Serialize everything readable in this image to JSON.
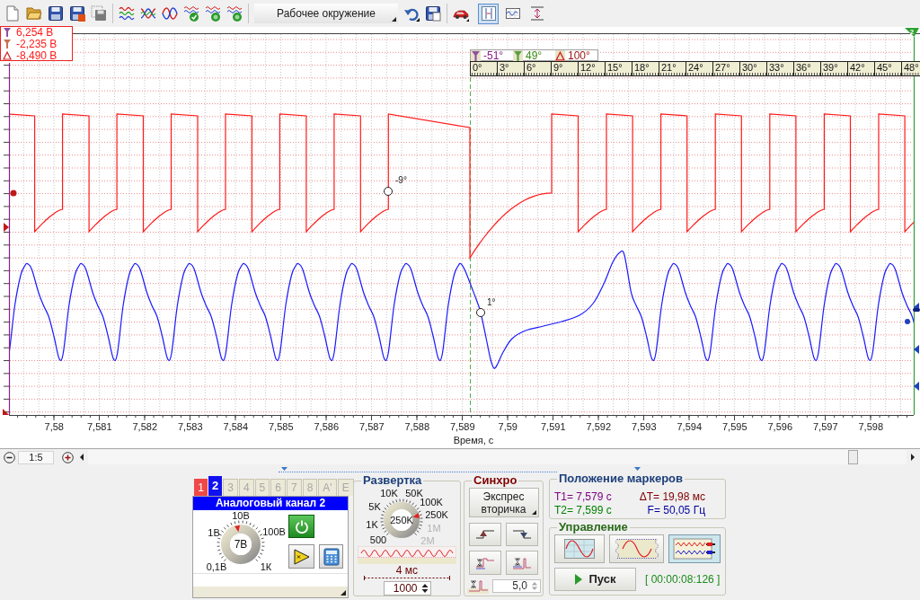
{
  "toolbar": {
    "workspace_dropdown": "Рабочее окружение",
    "view_toggles": [
      {
        "selected": true
      },
      {
        "selected": false
      },
      {
        "selected": false
      }
    ]
  },
  "plot": {
    "voltage_readout": [
      {
        "kind": "t1",
        "value": "6,254 В"
      },
      {
        "kind": "t2",
        "value": "-2,235 В"
      },
      {
        "kind": "delta",
        "value": "-8,490 В"
      }
    ],
    "cursor_t2_label": "2",
    "phase_readout": [
      {
        "kind": "t1",
        "value": "-51°",
        "color": "#8a1a8a"
      },
      {
        "kind": "t2",
        "value": "49°",
        "color": "#3a8a10"
      },
      {
        "kind": "delta",
        "value": "100°",
        "color": "#9a1010"
      }
    ],
    "phase_scale": [
      "0°",
      "3°",
      "6°",
      "9°",
      "12°",
      "15°",
      "18°",
      "21°",
      "24°",
      "27°",
      "30°",
      "33°",
      "36°",
      "39°",
      "42°",
      "45°",
      "48°"
    ],
    "point_labels": [
      "-9°",
      "1°"
    ],
    "x_axis": {
      "ticks": [
        "7,58",
        "7,581",
        "7,582",
        "7,583",
        "7,584",
        "7,585",
        "7,586",
        "7,587",
        "7,588",
        "7,589",
        "7,59",
        "7,591",
        "7,592",
        "7,593",
        "7,594",
        "7,595",
        "7,596",
        "7,597",
        "7,598"
      ],
      "label": "Время, с"
    }
  },
  "scroll": {
    "zoom": "1:5"
  },
  "channel_panel": {
    "tabs": [
      {
        "label": "1",
        "selected": false,
        "color": "#f04848"
      },
      {
        "label": "2",
        "selected": true,
        "color": "#1010f0"
      },
      {
        "label": "3",
        "selected": false
      },
      {
        "label": "4",
        "selected": false
      },
      {
        "label": "5",
        "selected": false
      },
      {
        "label": "6",
        "selected": false
      },
      {
        "label": "7",
        "selected": false
      },
      {
        "label": "8",
        "selected": false
      },
      {
        "label": "A'",
        "selected": false
      },
      {
        "label": "E",
        "selected": false
      }
    ],
    "title": "Аналоговый канал 2",
    "knob": {
      "value": "7В",
      "level": 0.46,
      "labels": [
        {
          "text": "10В",
          "enabled": true
        },
        {
          "text": "1В",
          "enabled": true
        },
        {
          "text": "100В",
          "enabled": true
        },
        {
          "text": "0,1В",
          "enabled": true
        },
        {
          "text": "1К",
          "enabled": true
        }
      ]
    },
    "power_on": true
  },
  "timebase_panel": {
    "title": "Развертка",
    "knob": {
      "value": "250K",
      "level": 0.78,
      "labels": [
        {
          "text": "10K",
          "enabled": true
        },
        {
          "text": "50K",
          "enabled": true
        },
        {
          "text": "5K",
          "enabled": true
        },
        {
          "text": "100K",
          "enabled": true
        },
        {
          "text": "250K",
          "enabled": true
        },
        {
          "text": "1K",
          "enabled": true
        },
        {
          "text": "1M",
          "enabled": false
        },
        {
          "text": "500",
          "enabled": true
        },
        {
          "text": "2M",
          "enabled": false
        }
      ]
    },
    "span": "4 мс",
    "points": "1000"
  },
  "sync_panel": {
    "title": "Синхро",
    "mode_button": "Экспрес вторичка",
    "threshold": "5,0"
  },
  "markers_panel": {
    "title": "Положение маркеров",
    "values": [
      {
        "text": "T1= 7,579 с",
        "color": "#800080"
      },
      {
        "text": "ΔT= 19,98 мс",
        "color": "#800000"
      },
      {
        "text": "T2= 7,599 с",
        "color": "#008000"
      },
      {
        "text": "F= 50,05 Гц",
        "color": "#0000a0"
      }
    ]
  },
  "control_panel": {
    "title": "Управление",
    "modes": [
      {
        "selected": false
      },
      {
        "selected": false
      },
      {
        "selected": true
      }
    ],
    "start_button": "Пуск",
    "elapsed": "[ 00:00:08:126 ]"
  }
}
